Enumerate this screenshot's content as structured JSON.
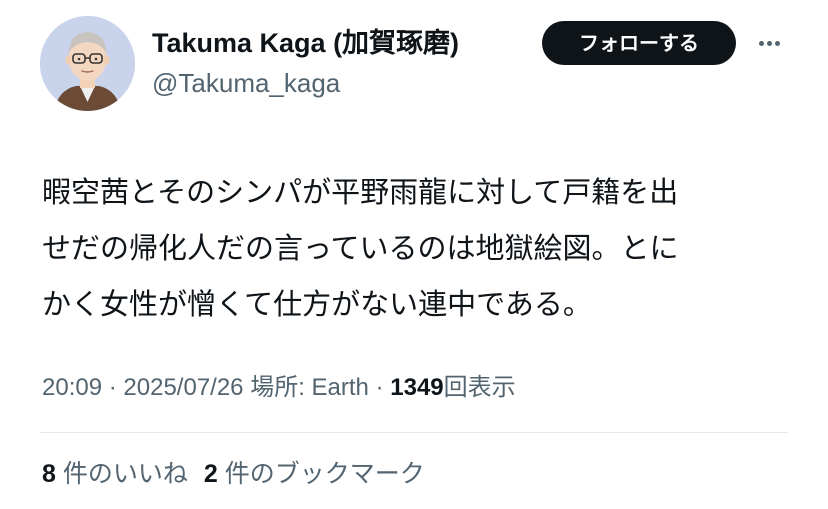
{
  "user": {
    "display_name": "Takuma Kaga (加賀琢磨)",
    "handle": "@Takuma_kaga"
  },
  "follow_button_label": "フォローする",
  "tweet": {
    "lines": [
      "暇空茜とそのシンパが平野雨龍に対して戸籍を出",
      "せだの帰化人だの言っているのは地獄絵図。とに",
      "かく女性が憎くて仕方がない連中である。"
    ]
  },
  "meta": {
    "time": "20:09",
    "sep1": "·",
    "date": "2025/07/26",
    "location_label": "場所: Earth",
    "sep2": "·",
    "views_count": "1349",
    "views_label": "回表示"
  },
  "stats": {
    "likes_count": "8",
    "likes_label": "件のいいね",
    "bookmarks_count": "2",
    "bookmarks_label": "件のブックマーク"
  },
  "colors": {
    "text": "#0f1419",
    "secondary": "#536471",
    "button_bg": "#0f1419",
    "avatar_bg": "#c9d3ec"
  },
  "icons": {
    "more": "more-dots-icon",
    "avatar": "cartoon-avatar"
  }
}
